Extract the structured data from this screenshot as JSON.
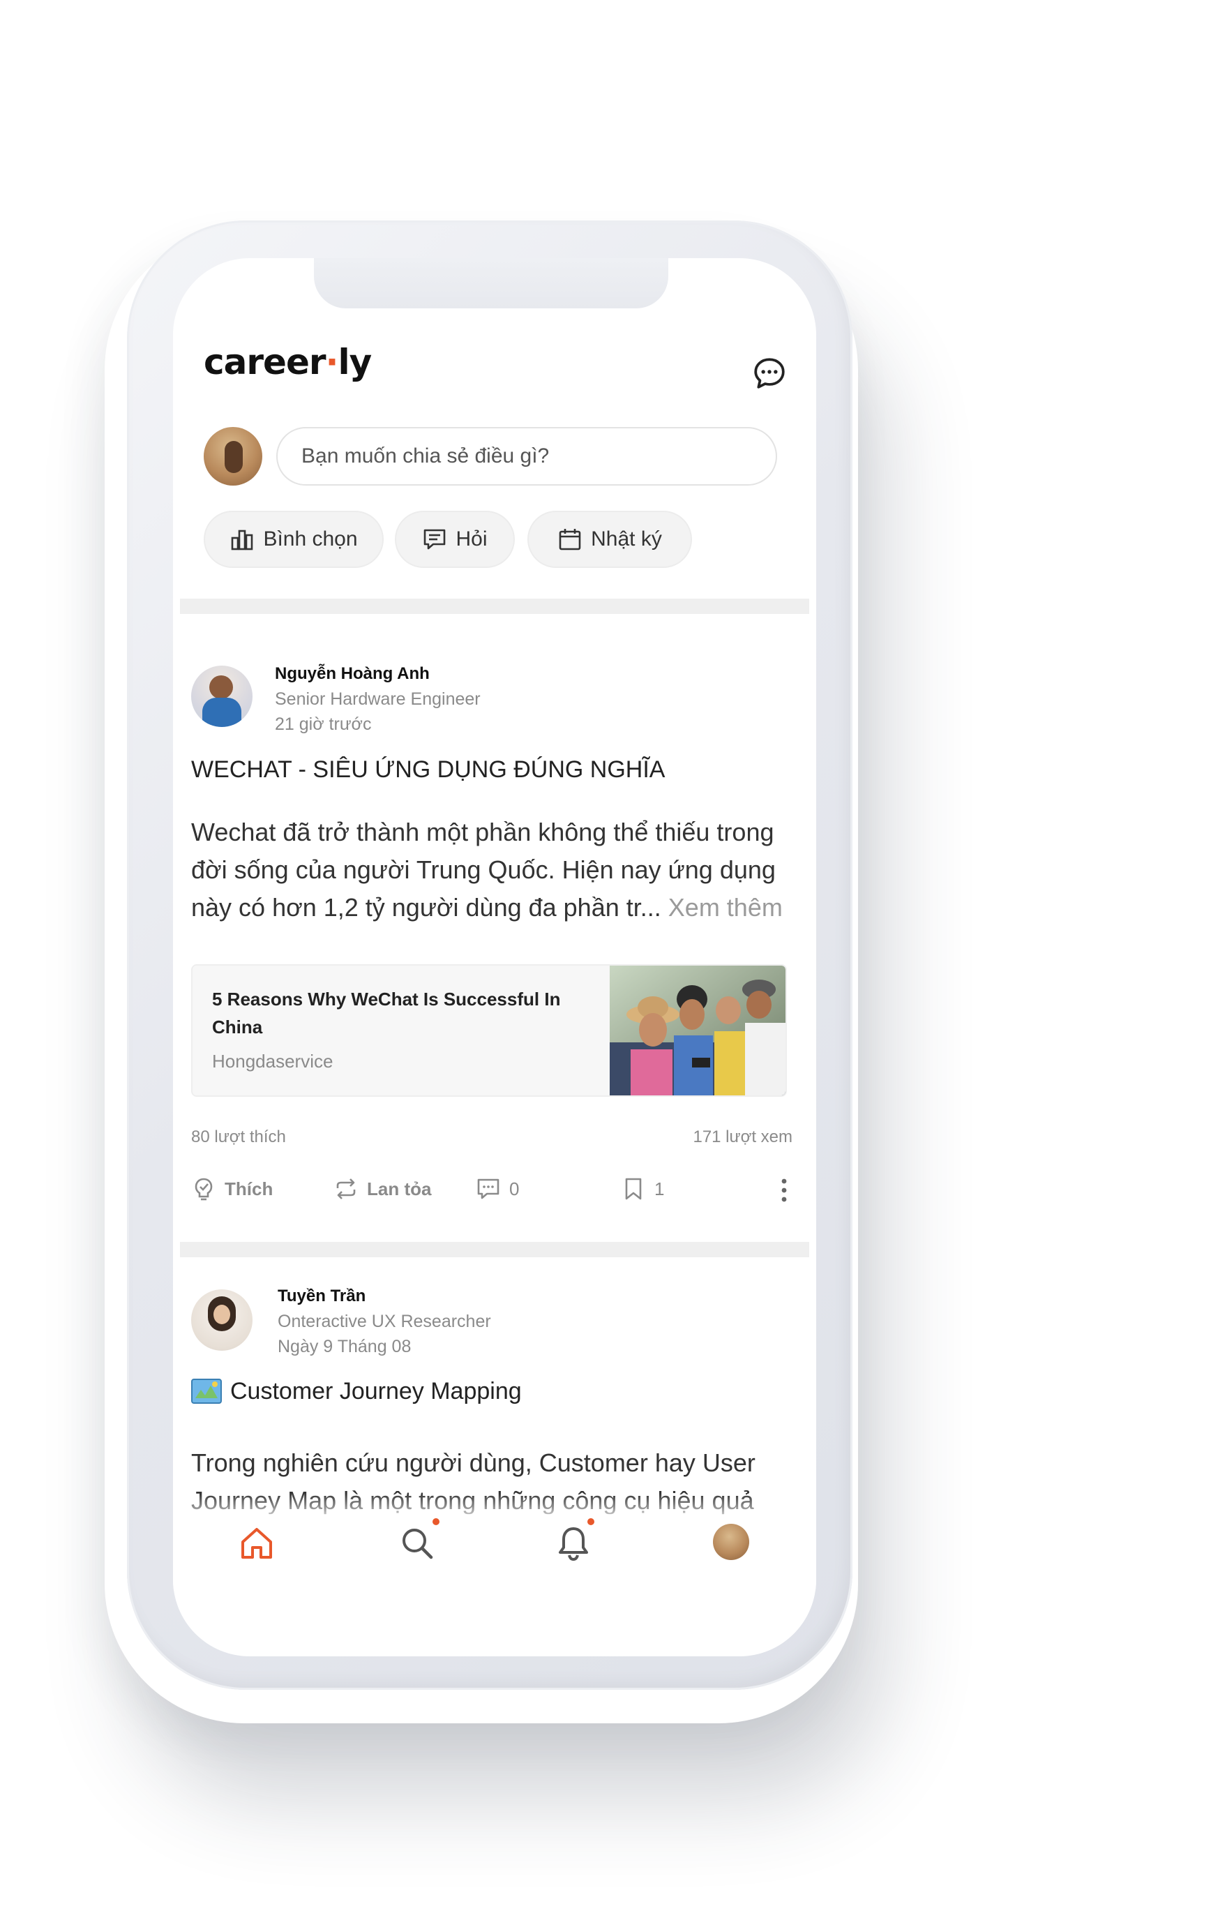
{
  "app": {
    "logo_text": "career",
    "logo_dot": "·",
    "logo_suffix": "ly",
    "brand_color": "#e8582b"
  },
  "composer": {
    "placeholder": "Bạn muốn chia sẻ điều gì?",
    "chips": [
      {
        "label": "Bình chọn",
        "icon": "poll-icon"
      },
      {
        "label": "Hỏi",
        "icon": "question-chat-icon"
      },
      {
        "label": "Nhật ký",
        "icon": "calendar-icon"
      }
    ]
  },
  "posts": [
    {
      "author": "Nguyễn Hoàng Anh",
      "role": "Senior Hardware Engineer",
      "time": "21 giờ trước",
      "title": "WECHAT - SIÊU ỨNG DỤNG ĐÚNG NGHĨA",
      "body": "Wechat đã trở thành một phần không thể thiếu trong đời sống của người Trung Quốc. Hiện nay ứng dụng này có hơn 1,2 tỷ người dùng đa phần tr...",
      "see_more": "Xem thêm",
      "link": {
        "title": "5 Reasons Why WeChat Is Successful In China",
        "source": "Hongdaservice"
      },
      "likes_text": "80 lượt thích",
      "views_text": "171 lượt xem",
      "actions": {
        "like": "Thích",
        "share": "Lan tỏa",
        "comments": "0",
        "bookmarks": "1"
      }
    },
    {
      "author": "Tuyền Trần",
      "role": "Onteractive UX Researcher",
      "time": "Ngày 9 Tháng 08",
      "title": "Customer Journey Mapping",
      "title_emoji": "map-icon",
      "body": "Trong nghiên cứu người dùng, Customer hay User Journey Map là một trong những công cụ hiệu quả"
    }
  ],
  "bottom_nav": {
    "items": [
      "home-icon",
      "search-icon",
      "bell-icon",
      "profile-avatar"
    ],
    "active": "home-icon",
    "badge_items": [
      "search-icon",
      "bell-icon"
    ]
  }
}
